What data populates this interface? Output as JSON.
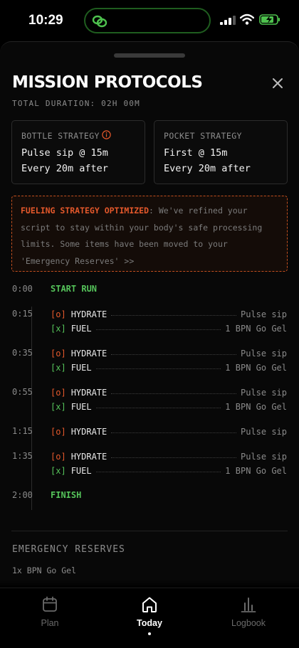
{
  "status_bar": {
    "time": "10:29"
  },
  "sheet": {
    "title": "MISSION PROTOCOLS",
    "duration": "TOTAL DURATION: 02H 00M",
    "cards": [
      {
        "label": "BOTTLE STRATEGY",
        "line1": "Pulse sip @ 15m",
        "line2": "Every 20m after",
        "icon": "info-icon"
      },
      {
        "label": "POCKET STRATEGY",
        "line1": "First @ 15m",
        "line2": "Every 20m after"
      }
    ],
    "alert": {
      "heading": "FUELING STRATEGY OPTIMIZED",
      "body": ": We've refined your script to stay within your body's safe processing limits. Some items have been moved to your 'Emergency Reserves' >>"
    },
    "timeline": {
      "start": {
        "time": "0:00",
        "label": "START RUN"
      },
      "blocks": [
        {
          "time": "0:15",
          "items": [
            {
              "tag": "[o]",
              "name": "HYDRATE",
              "value": "Pulse sip"
            },
            {
              "tag": "[x]",
              "name": "FUEL",
              "value": "1 BPN Go Gel"
            }
          ]
        },
        {
          "time": "0:35",
          "items": [
            {
              "tag": "[o]",
              "name": "HYDRATE",
              "value": "Pulse sip"
            },
            {
              "tag": "[x]",
              "name": "FUEL",
              "value": "1 BPN Go Gel"
            }
          ]
        },
        {
          "time": "0:55",
          "items": [
            {
              "tag": "[o]",
              "name": "HYDRATE",
              "value": "Pulse sip"
            },
            {
              "tag": "[x]",
              "name": "FUEL",
              "value": "1 BPN Go Gel"
            }
          ]
        },
        {
          "time": "1:15",
          "items": [
            {
              "tag": "[o]",
              "name": "HYDRATE",
              "value": "Pulse sip"
            }
          ]
        },
        {
          "time": "1:35",
          "items": [
            {
              "tag": "[o]",
              "name": "HYDRATE",
              "value": "Pulse sip"
            },
            {
              "tag": "[x]",
              "name": "FUEL",
              "value": "1 BPN Go Gel"
            }
          ]
        }
      ],
      "finish": {
        "time": "2:00",
        "label": "FINISH"
      }
    },
    "reserves": {
      "heading": "EMERGENCY RESERVES",
      "items": [
        "1x BPN Go Gel"
      ]
    }
  },
  "tabs": [
    {
      "label": "Plan",
      "icon": "calendar-icon",
      "active": false
    },
    {
      "label": "Today",
      "icon": "home-icon",
      "active": true
    },
    {
      "label": "Logbook",
      "icon": "bar-chart-icon",
      "active": false
    }
  ],
  "colors": {
    "accent_orange": "#e4582b",
    "accent_green": "#55c35a",
    "background": "#000000"
  }
}
